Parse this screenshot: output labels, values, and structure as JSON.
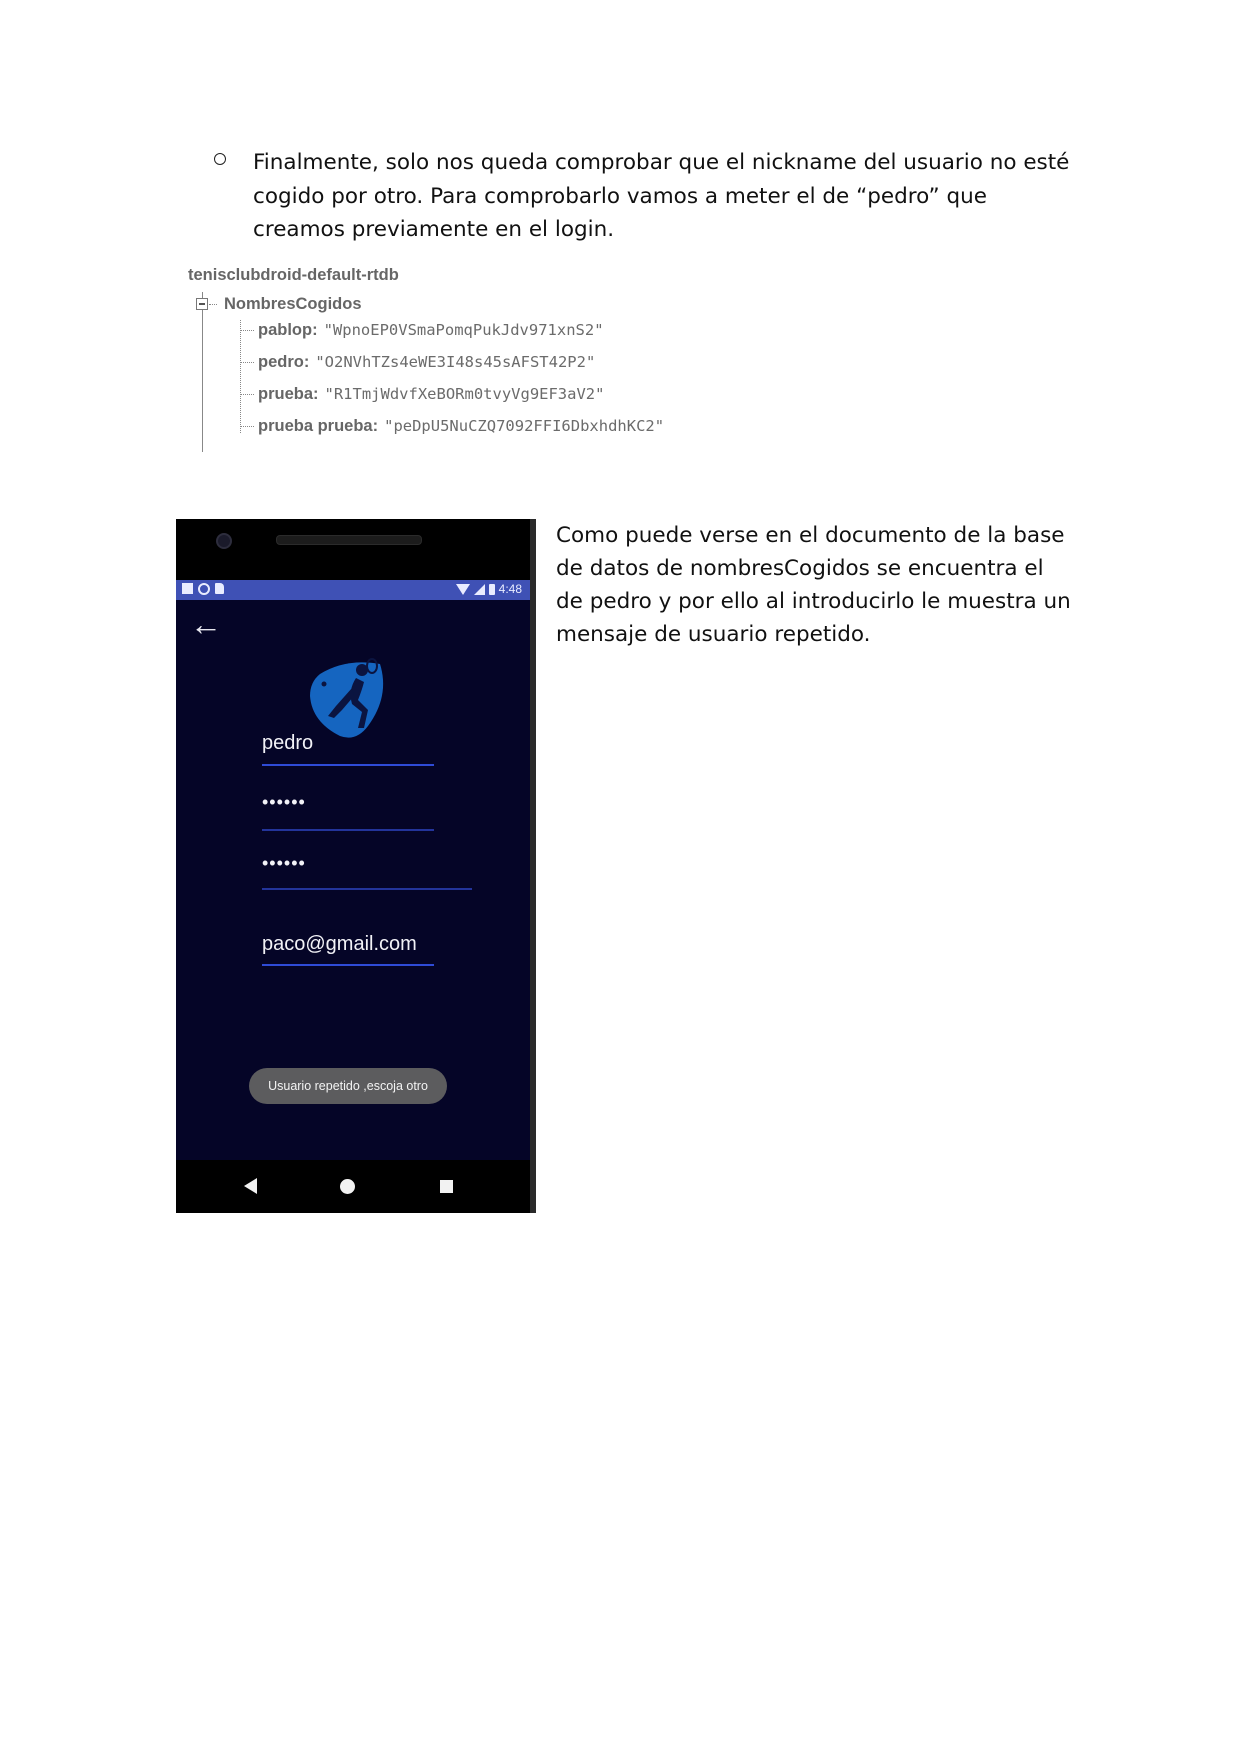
{
  "document": {
    "bullet_paragraph": "Finalmente, solo nos queda comprobar que el nickname del usuario no esté cogido por otro. Para comprobarlo vamos a meter el de “pedro” que creamos previamente en el login.",
    "side_paragraph": "Como puede verse en el documento de la base de datos de nombresCogidos se encuentra el de pedro y por ello al introducirlo le muestra un mensaje de usuario repetido."
  },
  "database": {
    "root": "tenisclubdroid-default-rtdb",
    "node": "NombresCogidos",
    "entries": [
      {
        "key": "pablop:",
        "value": "\"WpnoEP0VSmaPomqPukJdv971xnS2\""
      },
      {
        "key": "pedro:",
        "value": "\"O2NVhTZs4eWE3I48s45sAFST42P2\""
      },
      {
        "key": "prueba:",
        "value": "\"R1TmjWdvfXeBORm0tvyVg9EF3aV2\""
      },
      {
        "key": "prueba prueba:",
        "value": "\"peDpU5NuCZQ7092FFI6DbxhdhKC2\""
      }
    ]
  },
  "phone": {
    "status_time": "4:48",
    "fields": {
      "username": "pedro",
      "password": "••••••",
      "password_confirm": "••••••",
      "email": "paco@gmail.com"
    },
    "toast": "Usuario repetido ,escoja otro",
    "accent_color": "#3f51b5",
    "background_color": "#050527",
    "icons": {
      "back": "arrow-left-icon",
      "logo": "tennis-player-logo",
      "nav": [
        "nav-back-icon",
        "nav-home-icon",
        "nav-recents-icon"
      ]
    }
  }
}
